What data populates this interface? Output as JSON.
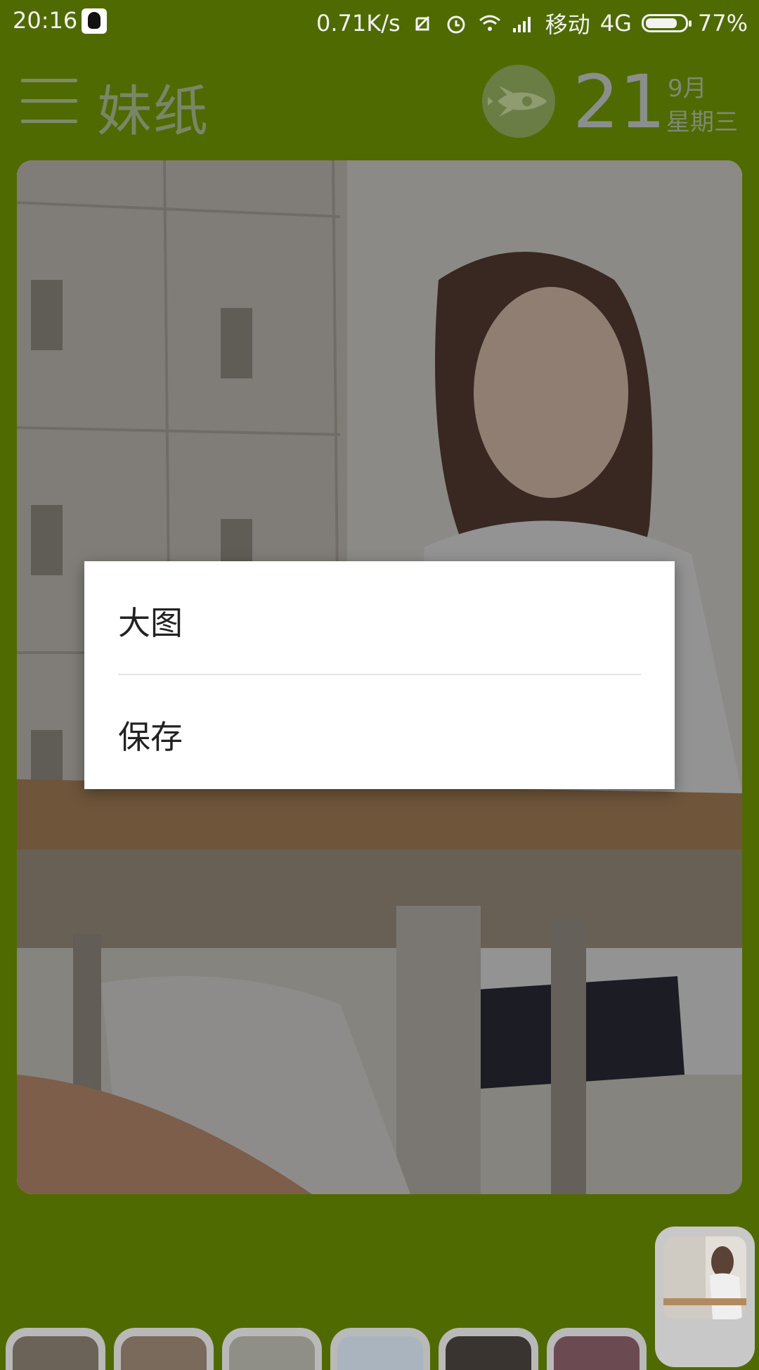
{
  "status_bar": {
    "time": "20:16",
    "speed": "0.71K/s",
    "carrier": "移动",
    "network": "4G",
    "battery": "77%",
    "battery_level": 0.77
  },
  "app_bar": {
    "title": "妹纸",
    "day": "21",
    "month": "9月",
    "weekday": "星期三"
  },
  "dialog": {
    "options": [
      "大图",
      "保存"
    ]
  },
  "icons": {
    "menu": "menu-icon",
    "rocket": "rocket-icon",
    "qq": "qq-notification-icon",
    "mute": "vibrate-off-icon",
    "alarm": "alarm-icon",
    "wifi": "wifi-icon",
    "signal": "signal-icon",
    "battery": "battery-icon"
  },
  "colors": {
    "background": "#4f6a00",
    "dialog": "#ffffff"
  }
}
